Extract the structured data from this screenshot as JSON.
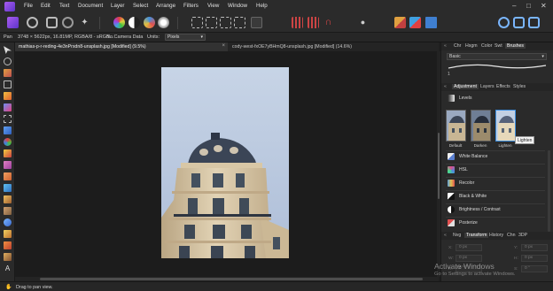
{
  "menubar": {
    "items": [
      "File",
      "Edit",
      "Text",
      "Document",
      "Layer",
      "Select",
      "Arrange",
      "Filters",
      "View",
      "Window",
      "Help"
    ]
  },
  "context_bar": {
    "tool_name": "Pan",
    "dimensions": "3748 × 5622px, 16.81MP, RGBA/8 - sRGB...",
    "camera": "No Camera Data",
    "units_label": "Units:",
    "units_value": "Pixels"
  },
  "document_tabs": [
    {
      "label": "mathias-p-r-reding-4e3nPrxdn8-unsplash.jpg [Modified] (9.5%)",
      "active": true
    },
    {
      "label": "cody-west-fxOE7yBHmQ8-unsplash.jpg [Modified] (14.6%)",
      "active": false
    }
  ],
  "right_panel": {
    "top_tabs": [
      "Chr",
      "Hsgm",
      "Color",
      "Swt",
      "Brushes"
    ],
    "active_top_tab": "Brushes",
    "brush_category": "Basic",
    "brush_size": "1",
    "mid_tabs": [
      "Adjustment",
      "Layers",
      "Effects",
      "Styles"
    ],
    "active_mid_tab": "Adjustment",
    "selected_adjustment": "Levels",
    "presets": [
      {
        "label": "Default"
      },
      {
        "label": "Darken"
      },
      {
        "label": "Lighten"
      }
    ],
    "tooltip": "Lighten",
    "adjustments": [
      {
        "label": "White Balance",
        "icon": "white-balance-icon",
        "color": "#e8e8e8"
      },
      {
        "label": "HSL",
        "icon": "hsl-icon",
        "color": "#e04b8a"
      },
      {
        "label": "Recolor",
        "icon": "recolor-icon",
        "color": "#5aa0e0"
      },
      {
        "label": "Black & White",
        "icon": "black-white-icon",
        "color": "#ffffff"
      },
      {
        "label": "Brightness / Contrast",
        "icon": "brightness-contrast-icon",
        "color": "#d0d0d0"
      },
      {
        "label": "Posterize",
        "icon": "posterize-icon",
        "color": "#e05050"
      }
    ],
    "bottom_tabs": [
      "Nvg",
      "Transform",
      "History",
      "Chn",
      "3DP"
    ],
    "active_bottom_tab": "Transform",
    "transform_fields": [
      {
        "label": "X:",
        "value": "0 px"
      },
      {
        "label": "Y:",
        "value": "0 px"
      },
      {
        "label": "W:",
        "value": "0 px"
      },
      {
        "label": "H:",
        "value": "0 px"
      },
      {
        "label": "R:",
        "value": "0 °"
      },
      {
        "label": "S:",
        "value": "0 °"
      }
    ]
  },
  "status": {
    "text": "Drag to pan view."
  },
  "watermark": {
    "title": "Activate Windows",
    "subtitle": "Go to Settings to activate Windows."
  },
  "colors": {
    "accent": "#3d8fe0",
    "brand": "#7e45e6",
    "sky": "#b9c9e0",
    "stone": "#d9c8a8",
    "dome": "#3a4456"
  }
}
